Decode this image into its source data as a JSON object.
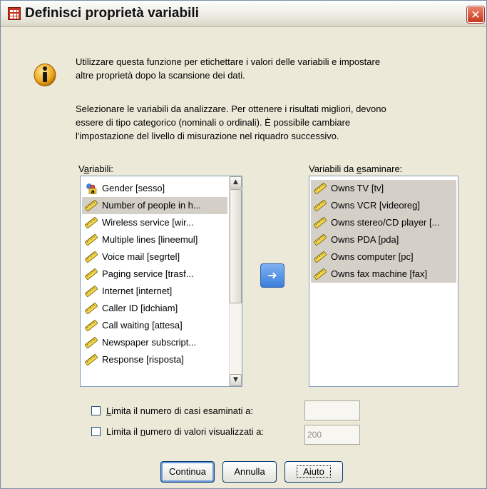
{
  "window": {
    "title": "Definisci proprietà variabili",
    "close_glyph": "✕"
  },
  "info": {
    "paragraph1_line1": "Utilizzare questa funzione per etichettare i valori delle variabili e impostare",
    "paragraph1_line2": "altre proprietà dopo la scansione dei dati.",
    "paragraph2_line1": "Selezionare le variabili da analizzare. Per ottenere i risultati migliori, devono",
    "paragraph2_line2": "essere di tipo categorico (nominali o ordinali). È possibile cambiare",
    "paragraph2_line3": "l'impostazione del livello di misurazione nel riquadro successivo."
  },
  "source_list": {
    "label_pre": "V",
    "label_ul": "a",
    "label_post": "riabili:",
    "items": [
      {
        "label": "Gender [sesso]",
        "icon": "nominal-icon",
        "selected": false
      },
      {
        "label": "Number of people in h...",
        "icon": "scale-ruler-icon",
        "selected": true
      },
      {
        "label": "Wireless service [wir...",
        "icon": "scale-ruler-icon",
        "selected": false
      },
      {
        "label": "Multiple lines [lineemul]",
        "icon": "scale-ruler-icon",
        "selected": false
      },
      {
        "label": "Voice mail [segrtel]",
        "icon": "scale-ruler-icon",
        "selected": false
      },
      {
        "label": "Paging service [trasf...",
        "icon": "scale-ruler-icon",
        "selected": false
      },
      {
        "label": "Internet [internet]",
        "icon": "scale-ruler-icon",
        "selected": false
      },
      {
        "label": "Caller ID [idchiam]",
        "icon": "scale-ruler-icon",
        "selected": false
      },
      {
        "label": "Call waiting [attesa]",
        "icon": "scale-ruler-icon",
        "selected": false
      },
      {
        "label": "Newspaper subscript...",
        "icon": "scale-ruler-icon",
        "selected": false
      },
      {
        "label": "Response [risposta]",
        "icon": "scale-ruler-icon",
        "selected": false
      }
    ]
  },
  "target_list": {
    "label_pre": "Variabili da ",
    "label_ul": "e",
    "label_post": "saminare:",
    "items": [
      {
        "label": "Owns TV [tv]",
        "icon": "scale-ruler-icon",
        "selected": true
      },
      {
        "label": "Owns VCR [videoreg]",
        "icon": "scale-ruler-icon",
        "selected": true
      },
      {
        "label": "Owns stereo/CD player [...",
        "icon": "scale-ruler-icon",
        "selected": true
      },
      {
        "label": "Owns PDA [pda]",
        "icon": "scale-ruler-icon",
        "selected": true
      },
      {
        "label": "Owns computer [pc]",
        "icon": "scale-ruler-icon",
        "selected": true
      },
      {
        "label": "Owns fax machine [fax]",
        "icon": "scale-ruler-icon",
        "selected": true
      }
    ]
  },
  "options": {
    "limit_cases": {
      "pre": "",
      "ul": "L",
      "post": "imita il numero di casi esaminati a:",
      "value": "",
      "checked": false
    },
    "limit_values": {
      "pre": "Limita il ",
      "ul": "n",
      "post": "umero di valori visualizzati a:",
      "value": "200",
      "checked": false
    }
  },
  "buttons": {
    "continue": "Continua",
    "cancel": "Annulla",
    "help": "Aiuto"
  },
  "icons": {
    "scroll_up": "▲",
    "scroll_down": "▼",
    "move_arrow": "➜"
  },
  "colors": {
    "dialog_bg": "#ECE9D8",
    "selection": "#D4D0C8",
    "accent": "#3B7FD9",
    "close": "#C7381D"
  }
}
